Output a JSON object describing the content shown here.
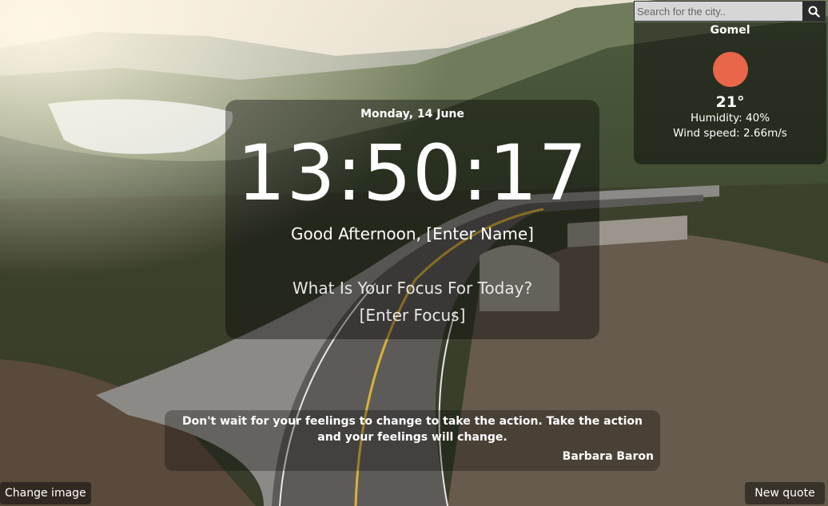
{
  "search": {
    "placeholder": "Search for the city..",
    "icon": "search-icon"
  },
  "weather": {
    "city": "Gomel",
    "temperature": "21°",
    "humidity": "Humidity: 40%",
    "wind": "Wind speed: 2.66m/s",
    "icon_color": "#e9664a"
  },
  "clock": {
    "date": "Monday, 14 June",
    "time": "13:50:17"
  },
  "greeting": {
    "text": "Good Afternoon,",
    "name": "[Enter Name]"
  },
  "focus": {
    "question": "What Is Your Focus For Today?",
    "value": "[Enter Focus]"
  },
  "quote": {
    "text": "Don't wait for your feelings to change to take the action. Take the action and your feelings will change.",
    "author": "Barbara Baron"
  },
  "buttons": {
    "change_image": "Change image",
    "new_quote": "New quote"
  }
}
